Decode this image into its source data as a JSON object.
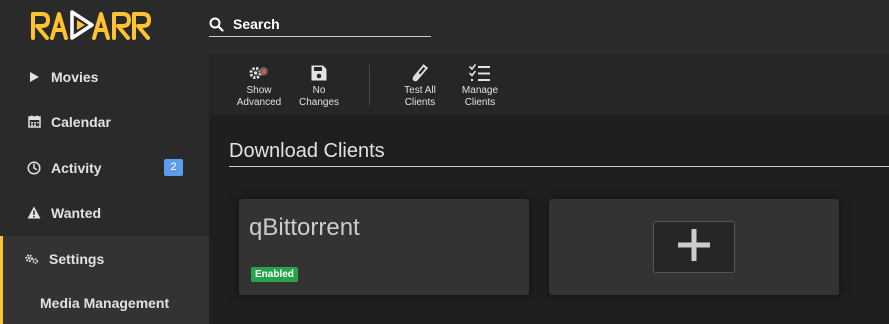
{
  "app": {
    "logo_text": "RADARR",
    "accent_color": "#ffc230"
  },
  "search": {
    "placeholder": "Search"
  },
  "sidebar": {
    "items": [
      {
        "label": "Movies",
        "icon": "play-icon"
      },
      {
        "label": "Calendar",
        "icon": "calendar-icon"
      },
      {
        "label": "Activity",
        "icon": "clock-icon",
        "badge": "2"
      },
      {
        "label": "Wanted",
        "icon": "warning-icon"
      },
      {
        "label": "Settings",
        "icon": "gears-icon"
      },
      {
        "label": "Media Management"
      }
    ]
  },
  "toolbar": {
    "show_advanced": {
      "line1": "Show",
      "line2": "Advanced"
    },
    "no_changes": {
      "line1": "No",
      "line2": "Changes"
    },
    "test_all": {
      "line1": "Test All",
      "line2": "Clients"
    },
    "manage": {
      "line1": "Manage",
      "line2": "Clients"
    }
  },
  "main": {
    "title": "Download Clients",
    "clients": [
      {
        "name": "qBittorrent",
        "status": "Enabled",
        "status_color": "#29a34a"
      }
    ]
  }
}
